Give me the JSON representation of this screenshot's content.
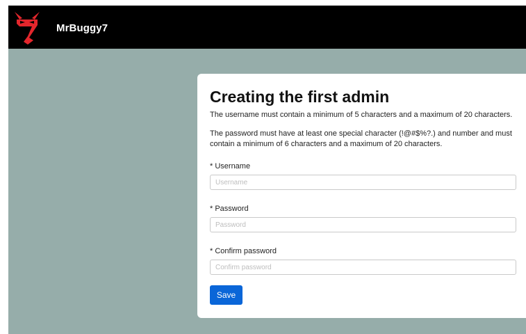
{
  "header": {
    "app_name": "MrBuggy7",
    "logo_icon": "devil-logo-icon",
    "background": "#000000",
    "logo_color": "#e3262c"
  },
  "page": {
    "background": "#96adaa"
  },
  "form": {
    "title": "Creating the first admin",
    "info_username": "The username must contain a minimum of 5 characters and a maximum of 20 characters.",
    "info_password": "The password must have at least one special character (!@#$%?.) and number and must contain a minimum of 6 characters and a maximum of 20 characters.",
    "required_marker": "*",
    "username": {
      "label": "Username",
      "placeholder": "Username",
      "value": ""
    },
    "password": {
      "label": "Password",
      "placeholder": "Password",
      "value": ""
    },
    "confirm_password": {
      "label": "Confirm password",
      "placeholder": "Confirm password",
      "value": ""
    },
    "save_label": "Save",
    "button_color": "#0a66d8"
  }
}
